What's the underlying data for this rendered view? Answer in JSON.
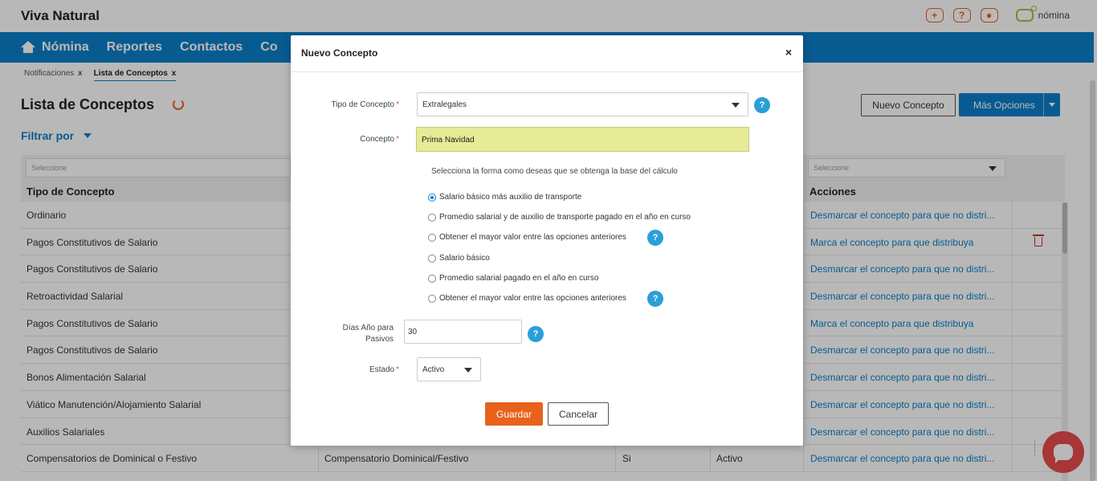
{
  "app": {
    "brand": "Viva Natural",
    "top_icons": [
      "plus-icon",
      "help-icon",
      "user-icon"
    ],
    "logo_text": "nómina"
  },
  "nav": {
    "items": [
      "Nómina",
      "Reportes",
      "Contactos",
      "Co"
    ]
  },
  "breadcrumb": {
    "items": [
      {
        "label": "Notificaciones",
        "close": "x"
      },
      {
        "label": "Lista de Conceptos",
        "close": "x"
      }
    ]
  },
  "page": {
    "title": "Lista de Conceptos",
    "filter_label": "Filtrar por",
    "new_button": "Nuevo Concepto",
    "more_button": "Más Opciones"
  },
  "table": {
    "filter_placeholder_1": "Seleccione",
    "filter_placeholder_2": "Seleccione",
    "headers": {
      "tipo": "Tipo de Concepto",
      "acciones": "Acciones"
    },
    "rows": [
      {
        "tipo": "Ordinario",
        "concepto": "",
        "col3": "",
        "estado": "",
        "accion": "Desmarcar el concepto para que no distri..."
      },
      {
        "tipo": "Pagos Constitutivos de Salario",
        "concepto": "",
        "col3": "",
        "estado": "",
        "accion": "Marca el concepto para que distribuya"
      },
      {
        "tipo": "Pagos Constitutivos de Salario",
        "concepto": "",
        "col3": "",
        "estado": "",
        "accion": "Desmarcar el concepto para que no distri..."
      },
      {
        "tipo": "Retroactividad Salarial",
        "concepto": "",
        "col3": "",
        "estado": "",
        "accion": "Desmarcar el concepto para que no distri..."
      },
      {
        "tipo": "Pagos Constitutivos de Salario",
        "concepto": "",
        "col3": "",
        "estado": "",
        "accion": "Marca el concepto para que distribuya"
      },
      {
        "tipo": "Pagos Constitutivos de Salario",
        "concepto": "",
        "col3": "",
        "estado": "",
        "accion": "Desmarcar el concepto para que no distri..."
      },
      {
        "tipo": "Bonos Alimentación Salarial",
        "concepto": "",
        "col3": "",
        "estado": "",
        "accion": "Desmarcar el concepto para que no distri..."
      },
      {
        "tipo": "Viático Manutención/Alojamiento Salarial",
        "concepto": "",
        "col3": "",
        "estado": "",
        "accion": "Desmarcar el concepto para que no distri..."
      },
      {
        "tipo": "Auxilios Salariales",
        "concepto": "",
        "col3": "",
        "estado": "",
        "accion": "Desmarcar el concepto para que no distri..."
      },
      {
        "tipo": "Compensatorios de Dominical o Festivo",
        "concepto": "Compensatorio Dominical/Festivo",
        "col3": "Si",
        "estado": "Activo",
        "accion": "Desmarcar el concepto para que no distri..."
      }
    ]
  },
  "modal": {
    "title": "Nuevo Concepto",
    "close": "×",
    "tipo_label": "Tipo de Concepto",
    "tipo_value": "Extralegales",
    "concepto_label": "Concepto",
    "concepto_value": "Prima Navidad",
    "hint": "Selecciona la forma como deseas que se obtenga la base del cálculo",
    "options": [
      "Salario básico más auxilio de transporte",
      "Promedio salarial y de auxilio de transporte pagado en el año en curso",
      "Obtener el mayor valor entre las opciones anteriores",
      "Salario básico",
      "Promedio salarial pagado en el año en curso",
      "Obtener el mayor valor entre las opciones anteriores"
    ],
    "selected_option": 0,
    "dias_label_1": "Días Año para",
    "dias_label_2": "Pasivos",
    "dias_value": "30",
    "estado_label": "Estado",
    "estado_value": "Activo",
    "required_mark": "*",
    "help_glyph": "?",
    "save_button": "Guardar",
    "cancel_button": "Cancelar"
  },
  "colors": {
    "primary": "#0b7fc8",
    "accent": "#e8621c",
    "highlight": "#e6eb96",
    "help": "#2a9fd8",
    "danger": "#c0392b",
    "chat": "#e84c4c"
  }
}
